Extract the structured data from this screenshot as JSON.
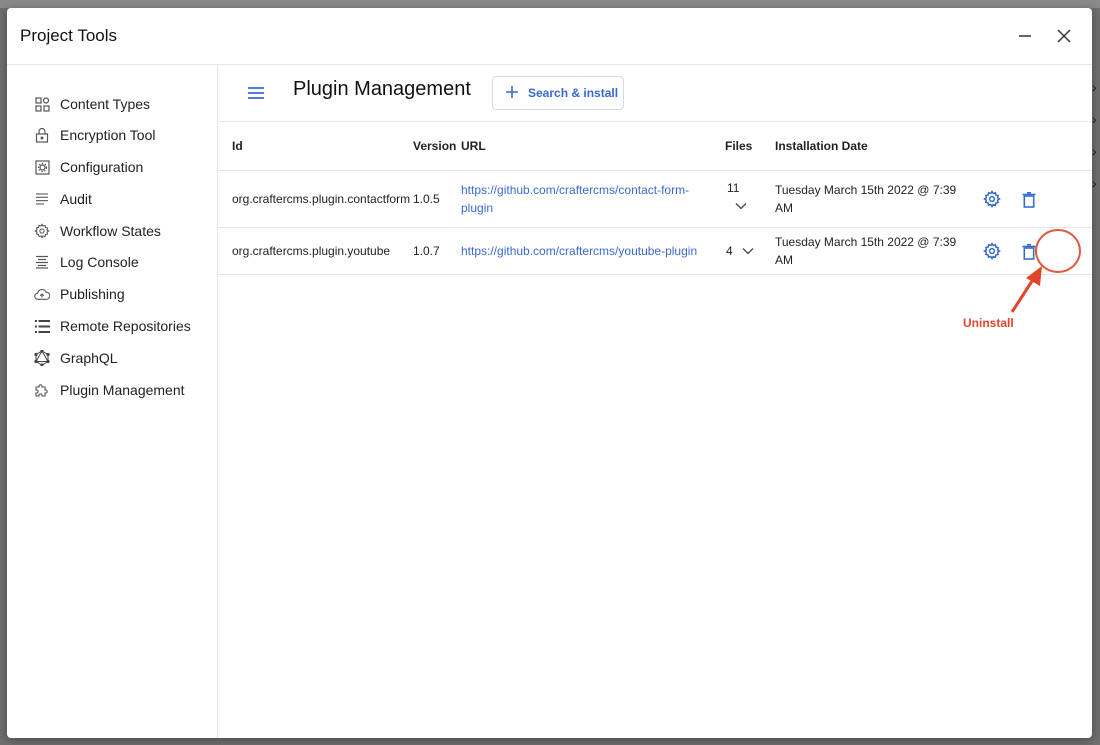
{
  "dialog": {
    "title": "Project Tools",
    "minimize_icon": "minimize-icon",
    "close_icon": "close-icon"
  },
  "sidebar": {
    "items": [
      {
        "label": "Content Types",
        "icon": "content-types-icon"
      },
      {
        "label": "Encryption Tool",
        "icon": "lock-icon"
      },
      {
        "label": "Configuration",
        "icon": "configuration-icon"
      },
      {
        "label": "Audit",
        "icon": "audit-lines-icon"
      },
      {
        "label": "Workflow States",
        "icon": "gear-icon"
      },
      {
        "label": "Log Console",
        "icon": "log-console-icon"
      },
      {
        "label": "Publishing",
        "icon": "cloud-upload-icon"
      },
      {
        "label": "Remote Repositories",
        "icon": "list-icon"
      },
      {
        "label": "GraphQL",
        "icon": "graphql-icon"
      },
      {
        "label": "Plugin Management",
        "icon": "puzzle-icon"
      }
    ]
  },
  "main": {
    "title": "Plugin Management",
    "search_install_label": "Search & install",
    "table": {
      "columns": [
        "Id",
        "Version",
        "URL",
        "Files",
        "Installation Date"
      ],
      "rows": [
        {
          "id": "org.craftercms.plugin.contactform",
          "version": "1.0.5",
          "url": "https://github.com/craftercms/contact-form-plugin",
          "files": "11",
          "installation_date": "Tuesday March 15th 2022 @ 7:39 AM"
        },
        {
          "id": "org.craftercms.plugin.youtube",
          "version": "1.0.7",
          "url": "https://github.com/craftercms/youtube-plugin",
          "files": "4",
          "installation_date": "Tuesday March 15th 2022 @ 7:39 AM"
        }
      ]
    }
  },
  "annotation": {
    "label": "Uninstall"
  },
  "colors": {
    "accent": "#3a6ad0",
    "annotation": "#e2452a"
  }
}
